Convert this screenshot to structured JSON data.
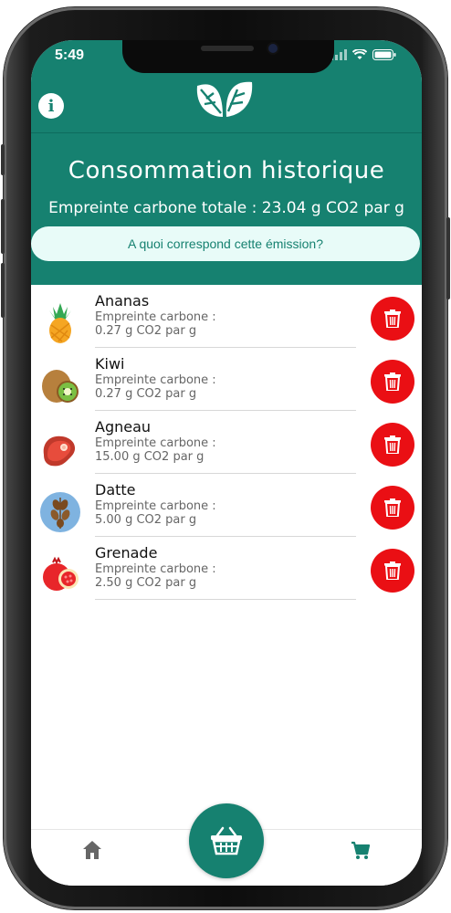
{
  "status_bar": {
    "time": "5:49"
  },
  "header": {
    "title": "Consommation historique",
    "total_emission": "Empreinte carbone totale : 23.04 g CO2 par g",
    "info_button": "A quoi correspond cette émission?"
  },
  "items": [
    {
      "name": "Ananas",
      "label": "Empreinte carbone :",
      "value": "0.27 g CO2 par g",
      "icon": "pineapple-icon"
    },
    {
      "name": "Kiwi",
      "label": "Empreinte carbone :",
      "value": "0.27 g CO2 par g",
      "icon": "kiwi-icon"
    },
    {
      "name": "Agneau",
      "label": "Empreinte carbone :",
      "value": "15.00 g CO2 par g",
      "icon": "meat-icon"
    },
    {
      "name": "Datte",
      "label": "Empreinte carbone :",
      "value": "5.00 g CO2 par g",
      "icon": "dates-icon"
    },
    {
      "name": "Grenade",
      "label": "Empreinte carbone :",
      "value": "2.50 g CO2 par g",
      "icon": "pomegranate-icon"
    }
  ],
  "colors": {
    "primary": "#168170",
    "delete": "#ea0f14",
    "pill": "#e8fbf8"
  }
}
